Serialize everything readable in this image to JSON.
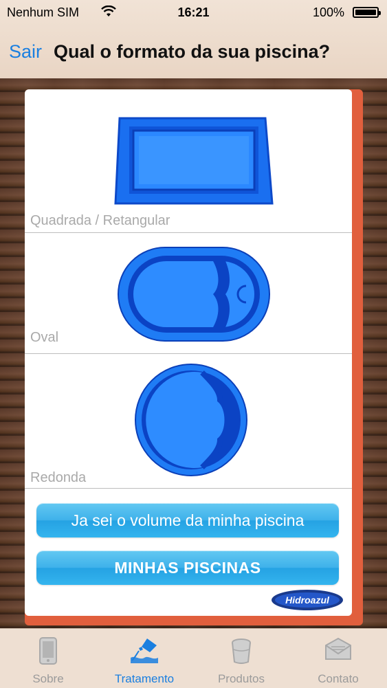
{
  "status_bar": {
    "carrier": "Nenhum SIM",
    "time": "16:21",
    "battery": "100%",
    "battery_level": 1.0
  },
  "nav": {
    "back_label": "Sair",
    "title": "Qual o formato da sua piscina?"
  },
  "shapes": [
    {
      "label": "Quadrada / Retangular",
      "icon": "rectangular-pool-icon"
    },
    {
      "label": "Oval",
      "icon": "oval-pool-icon"
    },
    {
      "label": "Redonda",
      "icon": "round-pool-icon"
    }
  ],
  "buttons": {
    "known_volume": "Ja sei o volume da minha piscina",
    "my_pools": "MINHAS PISCINAS"
  },
  "brand": {
    "logo_text": "Hidroazul"
  },
  "tabs": [
    {
      "label": "Sobre",
      "icon": "phone-icon",
      "active": false
    },
    {
      "label": "Tratamento",
      "icon": "pouring-bottle-icon",
      "active": true
    },
    {
      "label": "Produtos",
      "icon": "bucket-icon",
      "active": false
    },
    {
      "label": "Contato",
      "icon": "envelope-icon",
      "active": false
    }
  ],
  "colors": {
    "accent": "#1a7fe0",
    "pool_blue": "#1d78f0",
    "pool_dark": "#0b3fb8",
    "button_blue": "#34b4ee",
    "card_border": "#e15f3d"
  }
}
